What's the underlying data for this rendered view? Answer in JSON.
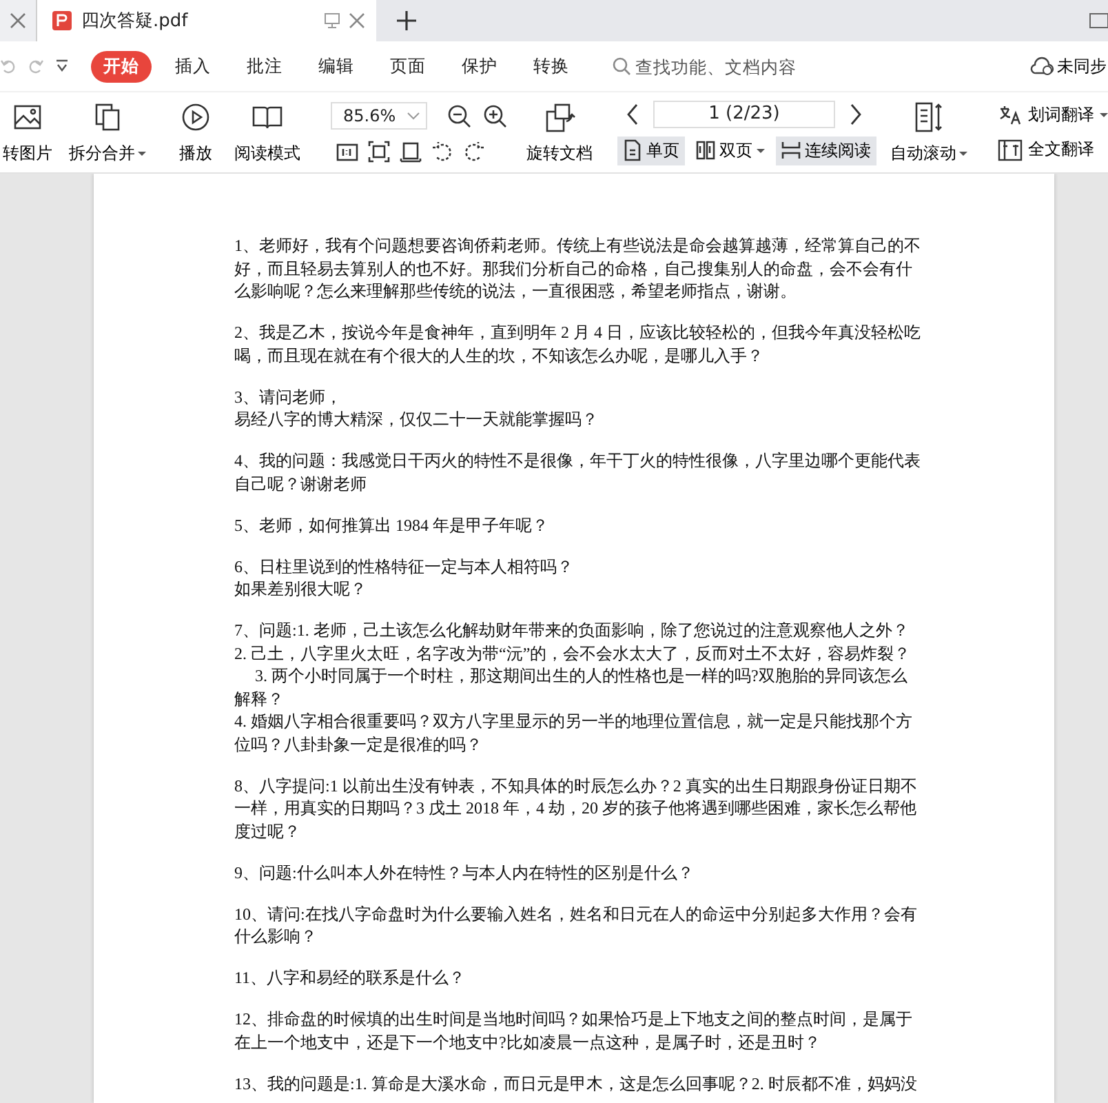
{
  "tabs": [
    {
      "label": "四次答疑.pdf",
      "selected": true
    }
  ],
  "ribbon": {
    "tabs": [
      {
        "label": "开始",
        "selected": true
      },
      {
        "label": "插入",
        "selected": false
      },
      {
        "label": "批注",
        "selected": false
      },
      {
        "label": "编辑",
        "selected": false
      },
      {
        "label": "页面",
        "selected": false
      },
      {
        "label": "保护",
        "selected": false
      },
      {
        "label": "转换",
        "selected": false
      }
    ],
    "search": {
      "placeholder": "查找功能、文档内容"
    },
    "sync": "未同步"
  },
  "toolbar": {
    "to_image": "转图片",
    "split_merge": "拆分合并",
    "play": "播放",
    "read_mode": "阅读模式",
    "zoom": "85.6%",
    "rotate": "旋转文档",
    "page": "1 (2/23)",
    "views": [
      {
        "label": "单页",
        "selected": true
      },
      {
        "label": "双页",
        "selected": false
      },
      {
        "label": "连续阅读",
        "selected": true
      }
    ],
    "auto_scroll": "自动滚动",
    "word_translate": "划词翻译",
    "full_translate": "全文翻译"
  },
  "document": {
    "paragraphs": [
      [
        "1、老师好，我有个问题想要咨询侨莉老师。传统上有些说法是命会越算越薄，经常算自己的不",
        "好，而且轻易去算别人的也不好。那我们分析自己的命格，自己搜集别人的命盘，会不会有什",
        "么影响呢？怎么来理解那些传统的说法，一直很困惑，希望老师指点，谢谢。"
      ],
      [
        "2、我是乙木，按说今年是食神年，直到明年 2 月 4 日，应该比较轻松的，但我今年真没轻松吃",
        "喝，而且现在就在有个很大的人生的坎，不知该怎么办呢，是哪儿入手？"
      ],
      [
        "3、请问老师，",
        "易经八字的博大精深，仅仅二十一天就能掌握吗？"
      ],
      [
        "4、我的问题：我感觉日干丙火的特性不是很像，年干丁火的特性很像，八字里边哪个更能代表",
        "自己呢？谢谢老师"
      ],
      [
        "5、老师，如何推算出 1984 年是甲子年呢？"
      ],
      [
        "6、日柱里说到的性格特征一定与本人相符吗？",
        "如果差别很大呢？"
      ],
      [
        "7、问题:1. 老师，己土该怎么化解劫财年带来的负面影响，除了您说过的注意观察他人之外？",
        "2. 己土，八字里火太旺，名字改为带“沅”的，会不会水太大了，反而对土不太好，容易炸裂？",
        "     3. 两个小时同属于一个时柱，那这期间出生的人的性格也是一样的吗?双胞胎的异同该怎么",
        "解释？",
        "4. 婚姻八字相合很重要吗？双方八字里显示的另一半的地理位置信息，就一定是只能找那个方",
        "位吗？八卦卦象一定是很准的吗？"
      ],
      [
        "8、八字提问:1 以前出生没有钟表，不知具体的时辰怎么办？2 真实的出生日期跟身份证日期不",
        "一样，用真实的日期吗？3 戊土 2018 年，4 劫，20 岁的孩子他将遇到哪些困难，家长怎么帮他",
        "度过呢？"
      ],
      [
        "9、问题:什么叫本人外在特性？与本人内在特性的区别是什么？"
      ],
      [
        "10、请问:在找八字命盘时为什么要输入姓名，姓名和日元在人的命运中分别起多大作用？会有",
        "什么影响？"
      ],
      [
        "11、八字和易经的联系是什么？"
      ],
      [
        "12、排命盘的时候填的出生时间是当地时间吗？如果恰巧是上下地支之间的整点时间，是属于",
        "在上一个地支中，还是下一个地支中?比如凌晨一点这种，是属子时，还是丑时？"
      ],
      [
        "13、我的问题是:1. 算命是大溪水命，而日元是甲木，这是怎么回事呢？2. 时辰都不准，妈妈没"
      ]
    ]
  }
}
